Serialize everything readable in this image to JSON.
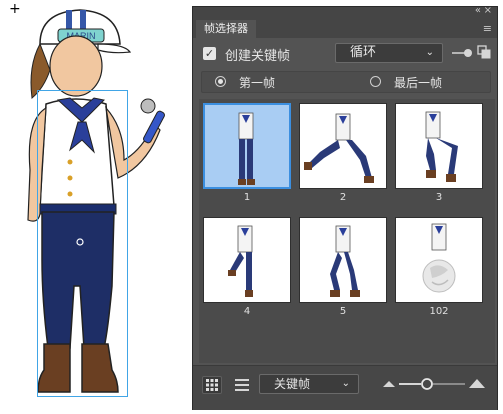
{
  "stage": {
    "crosshair_glyph": "+",
    "character_hat_text": "MARIN"
  },
  "panel": {
    "title_tab": "帧选择器",
    "collapse_glyph": "«",
    "close_glyph": "×",
    "menu_glyph": "≡",
    "create_keyframe": {
      "checked": true,
      "check_glyph": "✓",
      "label": "创建关键帧"
    },
    "loop_dropdown": {
      "value": "循环",
      "chevron": "⌄"
    },
    "radio_group": {
      "first_frame": {
        "label": "第一帧",
        "selected": true
      },
      "last_frame": {
        "label": "最后一帧",
        "selected": false
      }
    },
    "frames": [
      {
        "number": "1",
        "selected": true
      },
      {
        "number": "2",
        "selected": false
      },
      {
        "number": "3",
        "selected": false
      },
      {
        "number": "4",
        "selected": false
      },
      {
        "number": "5",
        "selected": false
      },
      {
        "number": "102",
        "selected": false
      }
    ],
    "bottom": {
      "view_dropdown": {
        "value": "关键帧",
        "chevron": "⌄"
      }
    }
  },
  "colors": {
    "panel_bg": "#535353",
    "selected_frame": "#a9cdf3",
    "selection_outline": "#41a5e6"
  }
}
